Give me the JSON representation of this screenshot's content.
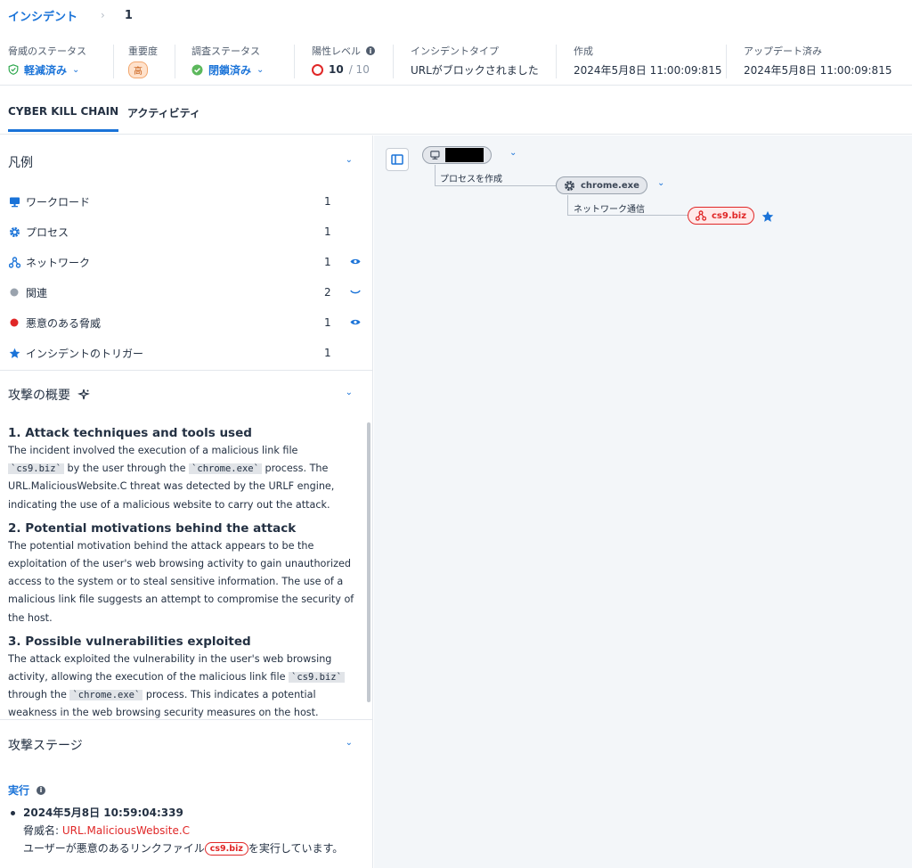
{
  "breadcrumb": {
    "parent": "インシデント",
    "separator": "›",
    "current": "1"
  },
  "info": {
    "threat_status": {
      "label": "脅威のステータス",
      "value": "軽減済み"
    },
    "severity": {
      "label": "重要度",
      "value": "高"
    },
    "investigation": {
      "label": "調査ステータス",
      "value": "閉鎖済み"
    },
    "positivity": {
      "label": "陽性レベル",
      "value": "10",
      "max": "/ 10"
    },
    "incident_type": {
      "label": "インシデントタイプ",
      "value": "URLがブロックされました"
    },
    "created": {
      "label": "作成",
      "value": "2024年5月8日 11:00:09:815"
    },
    "updated": {
      "label": "アップデート済み",
      "value": "2024年5月8日 11:00:09:815"
    }
  },
  "tabs": [
    "CYBER KILL CHAIN",
    "アクティビティ"
  ],
  "legend": {
    "title": "凡例",
    "items": [
      {
        "label": "ワークロード",
        "count": "1",
        "icon": "workload-icon"
      },
      {
        "label": "プロセス",
        "count": "1",
        "icon": "gear-icon"
      },
      {
        "label": "ネットワーク",
        "count": "1",
        "icon": "network-icon"
      },
      {
        "label": "関連",
        "count": "2",
        "icon": "grey-dot-icon"
      },
      {
        "label": "悪意のある脅威",
        "count": "1",
        "icon": "red-dot-icon"
      },
      {
        "label": "インシデントのトリガー",
        "count": "1",
        "icon": "star-icon"
      }
    ]
  },
  "summary": {
    "title": "攻撃の概要",
    "h1": "1. Attack techniques and tools used",
    "p1a": "The incident involved the execution of a malicious link file ",
    "code_cs9": "`cs9.biz`",
    "p1b": " by the user through the ",
    "code_chrome": "`chrome.exe`",
    "p1c": " process. The URL.MaliciousWebsite.C threat was detected by the URLF engine, indicating the use of a malicious website to carry out the attack.",
    "h2": "2. Potential motivations behind the attack",
    "p2": "The potential motivation behind the attack appears to be the exploitation of the user's web browsing activity to gain unauthorized access to the system or to steal sensitive information. The use of a malicious link file suggests an attempt to compromise the security of the host.",
    "h3": "3. Possible vulnerabilities exploited",
    "p3a": "The attack exploited the vulnerability in the user's web browsing activity, allowing the execution of the malicious link file ",
    "p3b": " through the ",
    "p3c": " process. This indicates a potential weakness in the web browsing security measures on the host."
  },
  "stages": {
    "title": "攻撃ステージ",
    "stage_name": "実行",
    "timestamp": "2024年5月8日 10:59:04:339",
    "threat_label": "脅威名: ",
    "threat_name": "URL.MaliciousWebsite.C",
    "desc_a": "ユーザーが悪意のあるリンクファイル",
    "desc_pill": "cs9.biz",
    "desc_b": "を実行しています。"
  },
  "graph": {
    "edge1": "プロセスを作成",
    "process": "chrome.exe",
    "edge2": "ネットワーク通信",
    "network": "cs9.biz"
  },
  "colors": {
    "accent": "#1a73d8",
    "danger": "#e02727",
    "text": "#243143"
  }
}
